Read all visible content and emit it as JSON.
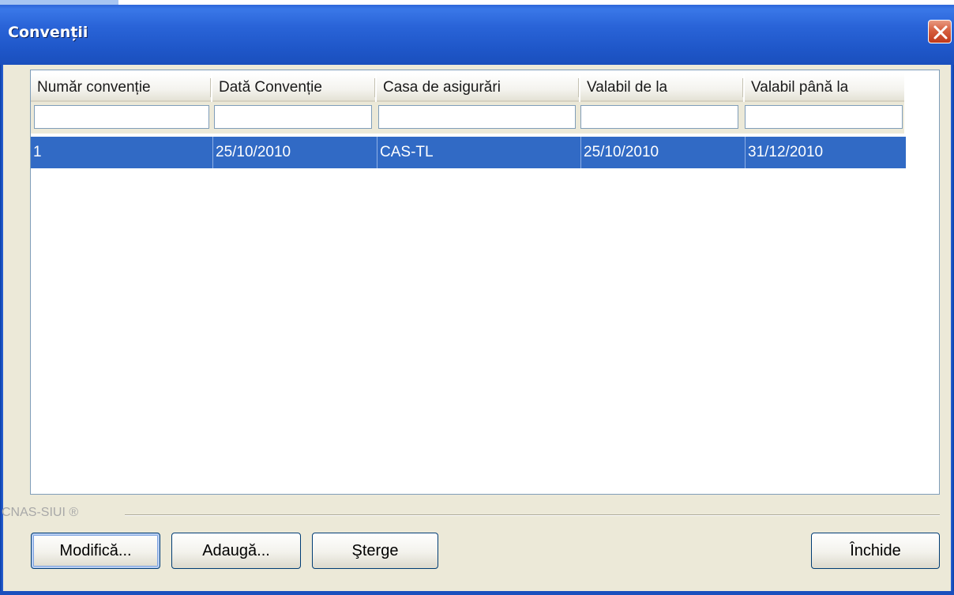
{
  "window": {
    "title": "Convenții"
  },
  "table": {
    "columns": [
      "Număr convenție",
      "Dată Convenție",
      "Casa de asigurări",
      "Valabil de la",
      "Valabil până la"
    ],
    "filters": [
      "",
      "",
      "",
      "",
      ""
    ],
    "rows": [
      {
        "cells": [
          "1",
          "25/10/2010",
          "CAS-TL",
          "25/10/2010",
          "31/12/2010"
        ],
        "selected": true
      }
    ]
  },
  "group": {
    "label": "CNAS-SIUI ®"
  },
  "buttons": {
    "modify": "Modifică...",
    "add": "Adaugă...",
    "delete": "Şterge",
    "close": "Închide"
  },
  "colors": {
    "titlebar": "#2a64d8",
    "selection": "#316ac5",
    "window_bg": "#ece9d8"
  },
  "icons": {
    "close": "close-icon"
  }
}
